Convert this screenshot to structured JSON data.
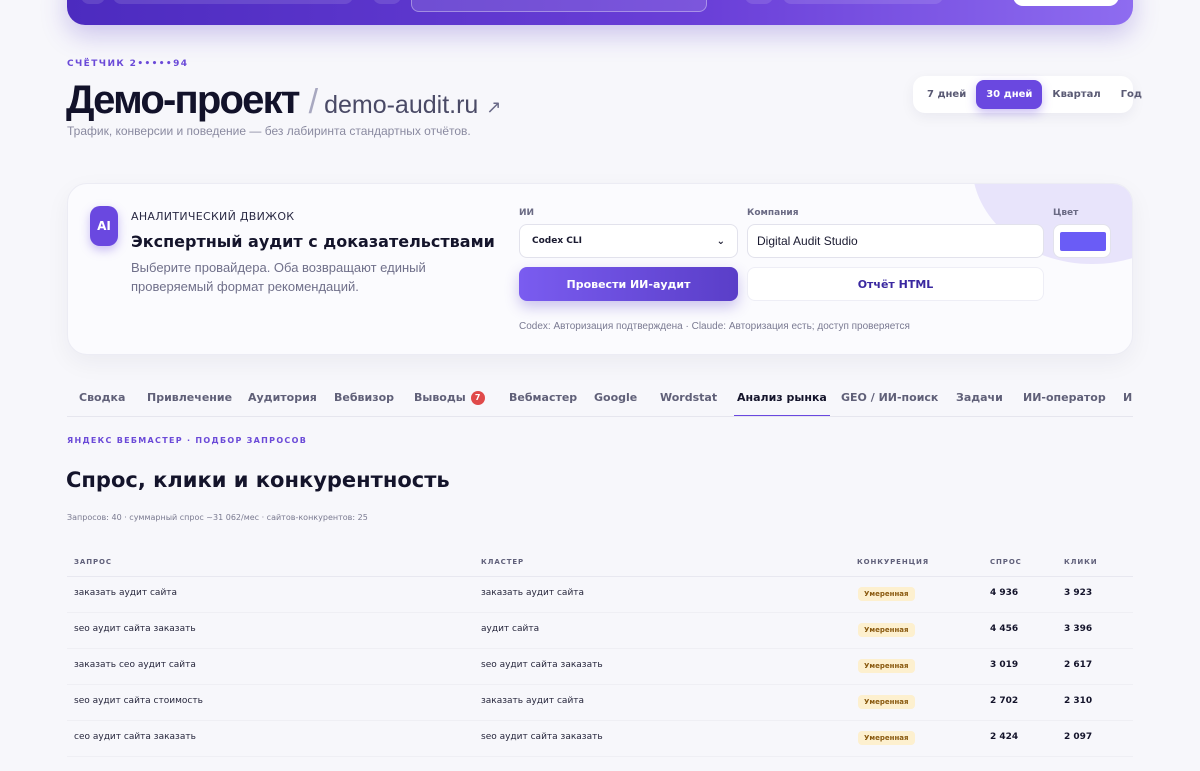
{
  "header": {
    "counter_label": "СЧЁТЧИК 2•••••94",
    "project_name": "Демо-проект",
    "separator": "/",
    "domain": "demo-audit.ru",
    "subtitle": "Трафик, конверсии и поведение — без лабиринта стандартных отчётов."
  },
  "period_filter": {
    "options": [
      "7 дней",
      "30 дней",
      "Квартал",
      "Год"
    ],
    "selected": "30 дней"
  },
  "ai_engine": {
    "badge": "AI",
    "kicker": "АНАЛИТИЧЕСКИЙ ДВИЖОК",
    "title": "Экспертный аудит с доказательствами",
    "description": "Выберите провайдера. Оба возвращают единый проверяемый формат рекомендаций.",
    "provider_label": "ИИ",
    "provider_value": "Codex CLI",
    "company_label": "Компания",
    "company_value": "Digital Audit Studio",
    "color_label": "Цвет",
    "color_value": "#6a5cf6",
    "run_button": "Провести ИИ-аудит",
    "report_button": "Отчёт HTML",
    "status": "Codex: Авторизация подтверждена · Claude: Авторизация есть; доступ проверяется"
  },
  "tabs": [
    {
      "label": "Сводка"
    },
    {
      "label": "Привлечение"
    },
    {
      "label": "Аудитория"
    },
    {
      "label": "Вебвизор"
    },
    {
      "label": "Выводы",
      "badge": "7"
    },
    {
      "label": "Вебмастер"
    },
    {
      "label": "Google"
    },
    {
      "label": "Wordstat"
    },
    {
      "label": "Анализ рынка",
      "active": true
    },
    {
      "label": "GEO / ИИ-поиск"
    },
    {
      "label": "Задачи"
    },
    {
      "label": "ИИ-оператор"
    },
    {
      "label": "И"
    }
  ],
  "section": {
    "kicker": "ЯНДЕКС ВЕБМАСТЕР · ПОДБОР ЗАПРОСОВ",
    "title": "Спрос, клики и конкурентность",
    "meta": "Запросов: 40 · суммарный спрос ~31 062/мес · сайтов-конкурентов: 25"
  },
  "table": {
    "columns": [
      "ЗАПРОС",
      "КЛАСТЕР",
      "КОНКУРЕНЦИЯ",
      "СПРОС",
      "КЛИКИ"
    ],
    "rows": [
      {
        "query": "заказать аудит сайта",
        "cluster": "заказать аудит сайта",
        "competition": "Умеренная",
        "demand": "4 936",
        "clicks": "3 923"
      },
      {
        "query": "seo аудит сайта заказать",
        "cluster": "аудит сайта",
        "competition": "Умеренная",
        "demand": "4 456",
        "clicks": "3 396"
      },
      {
        "query": "заказать сео аудит сайта",
        "cluster": "seo аудит сайта заказать",
        "competition": "Умеренная",
        "demand": "3 019",
        "clicks": "2 617"
      },
      {
        "query": "seo аудит сайта стоимость",
        "cluster": "заказать аудит сайта",
        "competition": "Умеренная",
        "demand": "2 702",
        "clicks": "2 310"
      },
      {
        "query": "сео аудит сайта заказать",
        "cluster": "seo аудит сайта заказать",
        "competition": "Умеренная",
        "demand": "2 424",
        "clicks": "2 097"
      }
    ]
  }
}
